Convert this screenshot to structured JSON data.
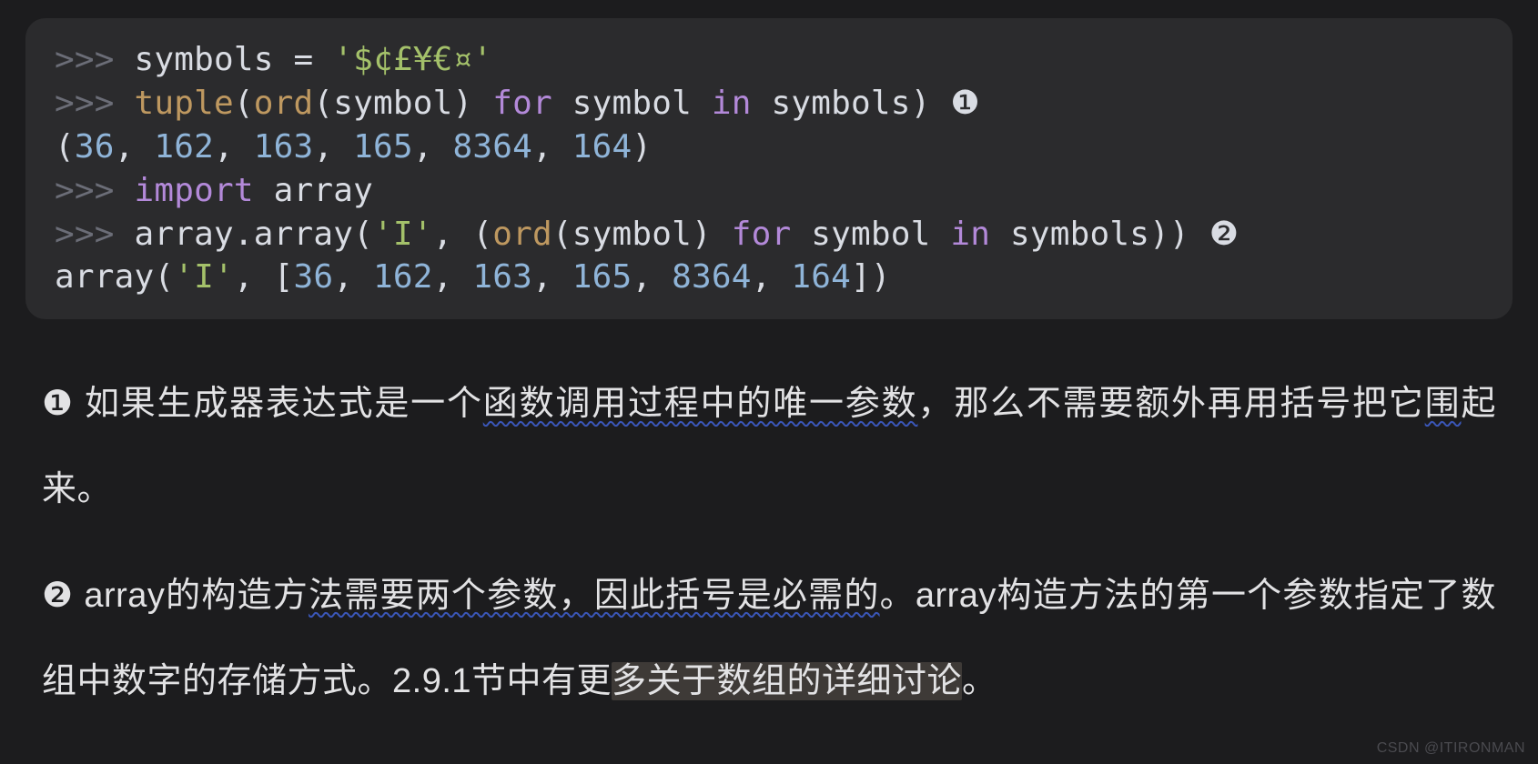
{
  "code": {
    "line1": {
      "prompt": ">>> ",
      "var": "symbols",
      "op": " = ",
      "str": "'$¢£¥€¤'"
    },
    "line2": {
      "prompt": ">>> ",
      "fn": "tuple",
      "lp": "(",
      "call": "ord",
      "lp2": "(",
      "arg": "symbol",
      "rp2": ") ",
      "kw1": "for",
      "sp1": " ",
      "var1": "symbol",
      "sp2": " ",
      "kw2": "in",
      "sp3": " ",
      "var2": "symbols",
      "rp": ") ",
      "circ": "❶"
    },
    "line3_open": "(",
    "line3_n1": "36",
    "line3_c1": ", ",
    "line3_n2": "162",
    "line3_c2": ", ",
    "line3_n3": "163",
    "line3_c3": ", ",
    "line3_n4": "165",
    "line3_c4": ", ",
    "line3_n5": "8364",
    "line3_c5": ", ",
    "line3_n6": "164",
    "line3_close": ")",
    "line4": {
      "prompt": ">>> ",
      "kw": "import",
      "sp": " ",
      "mod": "array"
    },
    "line5": {
      "prompt": ">>> ",
      "obj": "array.array(",
      "str": "'I'",
      "c1": ", (",
      "call": "ord",
      "lp": "(",
      "arg": "symbol",
      "rp": ") ",
      "kw1": "for",
      "sp1": " ",
      "var1": "symbol",
      "sp2": " ",
      "kw2": "in",
      "sp3": " ",
      "var2": "symbols",
      "rp2": ")) ",
      "circ": "❷"
    },
    "line6_a": "array(",
    "line6_str": "'I'",
    "line6_b": ", [",
    "line6_n1": "36",
    "line6_c1": ", ",
    "line6_n2": "162",
    "line6_c2": ", ",
    "line6_n3": "163",
    "line6_c3": ", ",
    "line6_n4": "165",
    "line6_c4": ", ",
    "line6_n5": "8364",
    "line6_c5": ", ",
    "line6_n6": "164",
    "line6_close": "])"
  },
  "notes": {
    "n1_circ": "❶",
    "n1_a": " 如果生成器表达式是一个",
    "n1_wavy": "函数调用过程中的唯一参数",
    "n1_b": "，那么不需要额外再用括号把它",
    "n1_wavy2": "围",
    "n1_c": "起来。",
    "n2_circ": "❷",
    "n2_a": " array的构造方",
    "n2_wavy": "法需要两个参数，因此括号是必需的",
    "n2_b": "。array构造方法的第一个参数指定了数组中数字的存储方式。2.9.1节中有更",
    "n2_hl": "多关于数组的详细讨论",
    "n2_c": "。"
  },
  "watermark": "CSDN @ITIRONMAN"
}
